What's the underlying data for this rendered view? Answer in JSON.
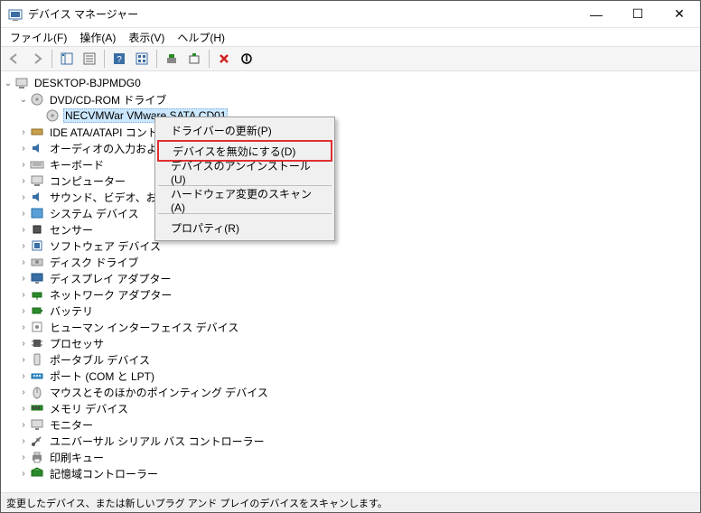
{
  "window": {
    "title": "デバイス マネージャー",
    "min": "—",
    "max": "☐",
    "close": "✕"
  },
  "menu": {
    "file": "ファイル(F)",
    "action": "操作(A)",
    "view": "表示(V)",
    "help": "ヘルプ(H)"
  },
  "tree": {
    "root": "DESKTOP-BJPMDG0",
    "dvd_category": "DVD/CD-ROM ドライブ",
    "dvd_device": "NECVMWar VMware SATA CD01",
    "ide": "IDE ATA/ATAPI コントローラー",
    "audio": "オーディオの入力および出力",
    "keyboard": "キーボード",
    "computer": "コンピューター",
    "svc": "サウンド、ビデオ、およびゲーム コントローラー",
    "sysdev": "システム デバイス",
    "sensor": "センサー",
    "software": "ソフトウェア デバイス",
    "disk": "ディスク ドライブ",
    "display": "ディスプレイ アダプター",
    "network": "ネットワーク アダプター",
    "battery": "バッテリ",
    "hid": "ヒューマン インターフェイス デバイス",
    "processor": "プロセッサ",
    "portable": "ポータブル デバイス",
    "ports": "ポート (COM と LPT)",
    "mouse": "マウスとそのほかのポインティング デバイス",
    "memory": "メモリ デバイス",
    "monitor": "モニター",
    "usb": "ユニバーサル シリアル バス コントローラー",
    "printq": "印刷キュー",
    "storage": "記憶域コントローラー"
  },
  "contextmenu": {
    "update_driver": "ドライバーの更新(P)",
    "disable_device": "デバイスを無効にする(D)",
    "uninstall_device": "デバイスのアンインストール(U)",
    "scan_hardware": "ハードウェア変更のスキャン(A)",
    "properties": "プロパティ(R)"
  },
  "statusbar": {
    "text": "変更したデバイス、または新しいプラグ アンド プレイのデバイスをスキャンします。"
  }
}
